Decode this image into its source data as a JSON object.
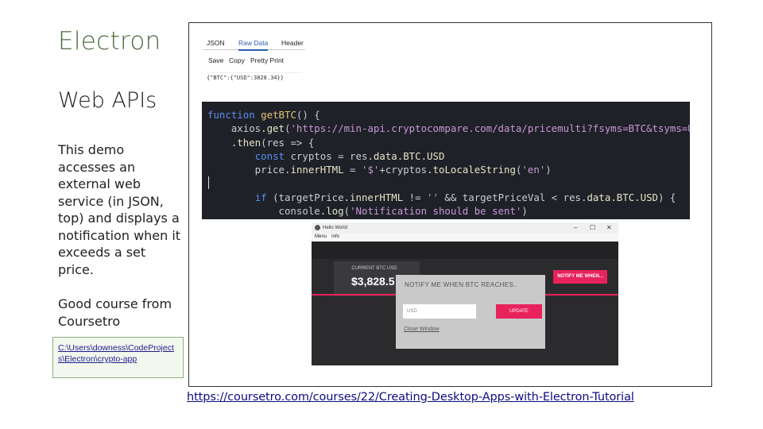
{
  "slide": {
    "title": "Electron",
    "subtitle": "Web APIs",
    "description": "This demo accesses an external web service (in JSON, top) and displays a notification when it exceeds a set price.",
    "course_note": "Good course from Coursetro",
    "file_path": "C:\\Users\\downess\\CodeProjects\\Electron\\crypto-app",
    "course_url": "https://coursetro.com/courses/22/Creating-Desktop-Apps-with-Electron-Tutorial"
  },
  "json_viewer": {
    "tabs": [
      "JSON",
      "Raw Data",
      "Header"
    ],
    "active_tab": "Raw Data",
    "toolbar": [
      "Save",
      "Copy",
      "Pretty Print"
    ],
    "raw": "{\"BTC\":{\"USD\":3828.34}}"
  },
  "code": {
    "lines": [
      "function getBTC() {",
      "    axios.get('https://min-api.cryptocompare.com/data/pricemulti?fsyms=BTC&tsyms=USD')",
      "    .then(res => {",
      "        const cryptos = res.data.BTC.USD",
      "        price.innerHTML = '$'+cryptos.toLocaleString('en')",
      "",
      "        if (targetPrice.innerHTML != '' && targetPriceVal < res.data.BTC.USD) {",
      "            console.log('Notification should be sent')"
    ]
  },
  "app_window": {
    "title": "Hello World",
    "menu": [
      "Menu",
      "Info"
    ],
    "price_label": "CURRENT BTC USD",
    "price_value": "$3,828.5",
    "notify_button": "NOTIFY ME WHEN...",
    "modal_title": "NOTIFY ME WHEN BTC REACHES..",
    "input_placeholder": "USD",
    "update_button": "UPDATE",
    "close_link": "Close Window",
    "controls": [
      "–",
      "☐",
      "✕"
    ]
  },
  "colors": {
    "title": "#4e6b3f",
    "accent": "#e8225b",
    "code_bg": "#1e2127",
    "link": "#0d0d80"
  }
}
